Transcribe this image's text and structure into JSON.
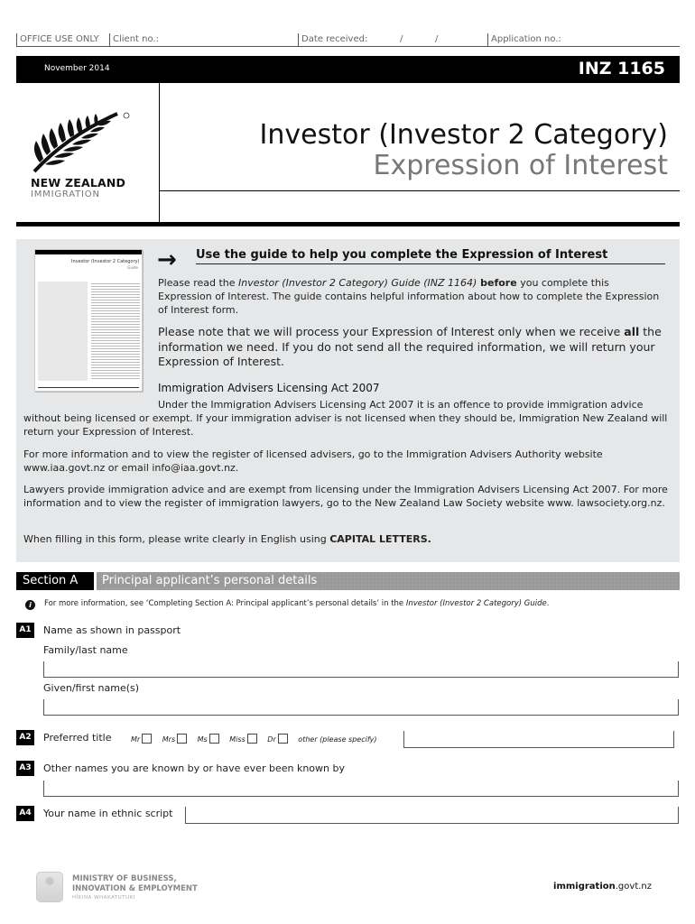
{
  "office": {
    "label": "OFFICE USE ONLY",
    "client_no": "Client no.:",
    "date_received": "Date received:",
    "slash": "/",
    "application_no": "Application no.:"
  },
  "topbar": {
    "date": "November 2014",
    "form_code": "INZ 1165"
  },
  "logo": {
    "icon": "silver-fern-icon",
    "line1": "NEW ZEALAND",
    "line2": "IMMIGRATION",
    "trademark": "®"
  },
  "title": {
    "main": "Investor (Investor 2 Category)",
    "sub": "Expression of Interest"
  },
  "guide_thumbnail": {
    "title": "Investor (Investor 2 Category)",
    "subtitle": "Guide"
  },
  "intro": {
    "arrow_icon": "arrow-right-icon",
    "heading": "Use the guide to help you complete the Expression of Interest",
    "p1_a": "Please read the ",
    "p1_italic": "Investor (Investor 2 Category) Guide (INZ 1164)",
    "p1_bold": " before",
    "p1_b": " you complete this Expression of Interest. The guide contains helpful information about how to complete the Expression of Interest form.",
    "p2_a": "Please note that we will process your Expression of Interest only when we receive ",
    "p2_bold": "all",
    "p2_b": " the information we need. If you do not send all the required information, we will return your Expression of Interest.",
    "act_heading": "Immigration Advisers Licensing Act 2007",
    "p3": "Under the Immigration Advisers Licensing Act 2007 it is an offence to provide immigration advice without being licensed or exempt. If your immigration adviser is not licensed when they should be, Immigration New Zealand will return your Expression of Interest.",
    "p4": "For more information and to view the register of licensed advisers, go to the Immigration Advisers Authority website www.iaa.govt.nz or email info@iaa.govt.nz.",
    "p5": "Lawyers provide immigration advice and are exempt from licensing under the Immigration Advisers Licensing Act 2007. For more information and to view the register of immigration lawyers, go to the New Zealand Law Society website www. lawsociety.org.nz.",
    "p6_a": "When filling in this form, please write clearly in English using ",
    "p6_bold": "CAPITAL LETTERS."
  },
  "section_a": {
    "tag": "Section A",
    "title": "Principal applicant’s personal details",
    "info_icon": "info-icon",
    "info_a": "For more information, see ‘Completing Section A: Principal applicant’s personal details’ in the ",
    "info_italic": "Investor (Investor 2 Category) Guide",
    "info_b": "."
  },
  "questions": {
    "a1": {
      "num": "A1",
      "label": "Name as shown in passport",
      "family_label": "Family/last name",
      "family_value": "",
      "given_label": "Given/first name(s)",
      "given_value": ""
    },
    "a2": {
      "num": "A2",
      "label": "Preferred title",
      "options": [
        "Mr",
        "Mrs",
        "Ms",
        "Miss",
        "Dr"
      ],
      "checked": [
        false,
        false,
        false,
        false,
        false
      ],
      "other_label": "other (please specify)",
      "other_value": ""
    },
    "a3": {
      "num": "A3",
      "label": "Other names you are known by or have ever been known by",
      "value": ""
    },
    "a4": {
      "num": "A4",
      "label": "Your name in ethnic script",
      "value": ""
    }
  },
  "footer": {
    "ministry_line1": "MINISTRY OF BUSINESS,",
    "ministry_line2": "INNOVATION & EMPLOYMENT",
    "ministry_line3": "HĪKINA WHAKATUTUKI",
    "site_bold": "immigration",
    "site_rest": ".govt.nz"
  }
}
